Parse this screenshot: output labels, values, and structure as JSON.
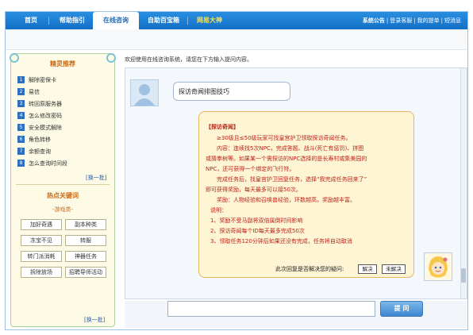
{
  "nav": {
    "tabs": [
      "首页",
      "帮助指引",
      "在线咨询",
      "自助百宝箱",
      "网易大神"
    ],
    "links": [
      "系统公告",
      "登录客服",
      "我的提单",
      "短消息"
    ]
  },
  "sidebar": {
    "title": "精灵推荐",
    "items": [
      {
        "num": "1",
        "label": "解除密保卡"
      },
      {
        "num": "2",
        "label": "易信"
      },
      {
        "num": "3",
        "label": "转回原服务器"
      },
      {
        "num": "4",
        "label": "怎么修改密码"
      },
      {
        "num": "5",
        "label": "安全模式解除"
      },
      {
        "num": "6",
        "label": "角色转移"
      },
      {
        "num": "7",
        "label": "余额查询"
      },
      {
        "num": "8",
        "label": "怎么查询时间段"
      }
    ],
    "more1": "[换一批]",
    "hot_title": "热点关键词",
    "hot_sub": "-游戏类-",
    "keywords": [
      "加好奇遇",
      "副本种类",
      "冻宝不见",
      "转服",
      "转门派消耗",
      "神器任务",
      "拆除放场",
      "招聘导师活动"
    ],
    "more2": "[换一批]"
  },
  "main": {
    "welcome": "欢迎使用在线咨询系统，请您在下方输入提问内容。",
    "user_msg": "探访奇闻排图技巧",
    "reply": {
      "title": "【探访奇闻】",
      "lines": [
        "≥30级且≤50级玩家可找皇宫护卫领取探访奇闻任务。",
        "内容：连续找5次NPC，完成答题、战斗(死亡有惩罚)、拼图",
        "或猜拳树等。如果某一个需探访的NPC选择的是长寿村或集美园的",
        "NPC，还可获得一个绑定的飞行符。",
        "完成任务后，找皇宫护卫回复任务，选择“我完成任务回来了”",
        "即可获得奖励，每天最多可以接50次。",
        "奖励：人物经验和召唤兽经验，环数越高，奖励越丰富。",
        "说明：",
        "1、奖励不受马副将双倍属倒时间影响",
        "2、探访奇闻每个ID每天最多完成50次",
        "3、领取任务120分钟后如果还没有完成，任务将自动取消"
      ],
      "feedback_q": "此次回复是否解决您的疑问:",
      "solved_btn": "解决",
      "unsolved_btn": "未解决"
    },
    "ask_label": "提 问"
  }
}
